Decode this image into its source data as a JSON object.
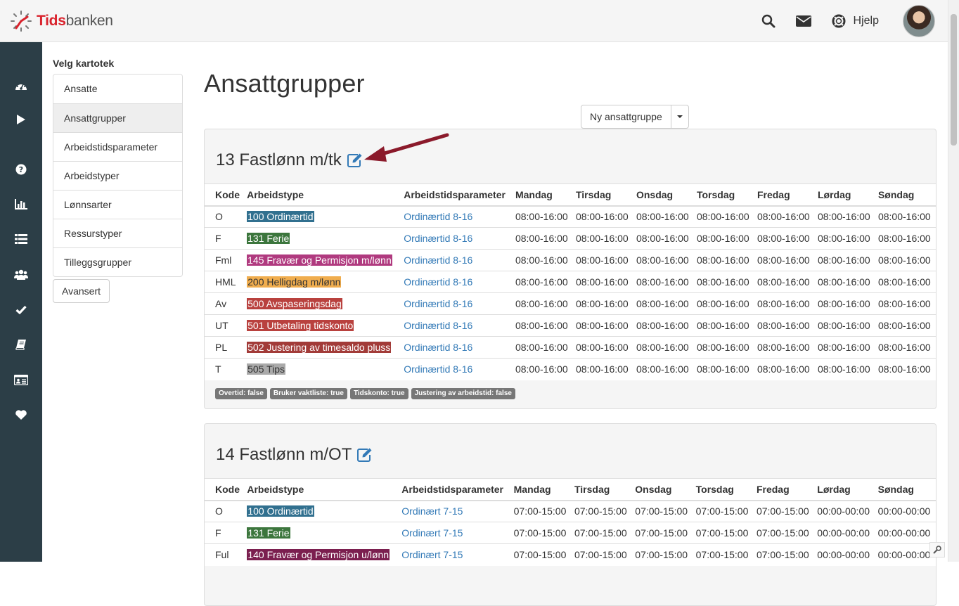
{
  "header": {
    "logo_part1": "Tids",
    "logo_part2": "banken",
    "help_label": "Hjelp",
    "icons": [
      "search-icon",
      "envelope-icon",
      "lifebuoy-icon"
    ]
  },
  "sidebar_icons": [
    "dashboard-icon",
    "play-icon",
    "question-icon",
    "bar-chart-icon",
    "list-icon",
    "users-icon",
    "check-icon",
    "book-icon",
    "id-card-icon",
    "heart-icon"
  ],
  "leftnav": {
    "title": "Velg kartotek",
    "items": [
      "Ansatte",
      "Ansattgrupper",
      "Arbeidstidsparameter",
      "Arbeidstyper",
      "Lønnsarter",
      "Ressurstyper",
      "Tilleggsgrupper"
    ],
    "active": "Ansattgrupper",
    "advanced_button": "Avansert"
  },
  "main": {
    "title": "Ansattgrupper",
    "new_button": "Ny ansattgruppe"
  },
  "table_headers": [
    "Kode",
    "Arbeidstype",
    "Arbeidstidsparameter",
    "Mandag",
    "Tirsdag",
    "Onsdag",
    "Torsdag",
    "Fredag",
    "Lørdag",
    "Søndag"
  ],
  "groups": [
    {
      "title": "13 Fastlønn m/tk",
      "rows": [
        {
          "kode": "O",
          "type": "100 Ordinærtid",
          "color": "#31708f",
          "param": "Ordinærtid 8-16",
          "days": [
            "08:00-16:00",
            "08:00-16:00",
            "08:00-16:00",
            "08:00-16:00",
            "08:00-16:00",
            "08:00-16:00",
            "08:00-16:00"
          ]
        },
        {
          "kode": "F",
          "type": "131 Ferie",
          "color": "#3c763d",
          "param": "Ordinærtid 8-16",
          "days": [
            "08:00-16:00",
            "08:00-16:00",
            "08:00-16:00",
            "08:00-16:00",
            "08:00-16:00",
            "08:00-16:00",
            "08:00-16:00"
          ]
        },
        {
          "kode": "Fml",
          "type": "145 Fravær og Permisjon m/lønn",
          "color": "#b03a7f",
          "param": "Ordinærtid 8-16",
          "days": [
            "08:00-16:00",
            "08:00-16:00",
            "08:00-16:00",
            "08:00-16:00",
            "08:00-16:00",
            "08:00-16:00",
            "08:00-16:00"
          ]
        },
        {
          "kode": "HML",
          "type": "200 Helligdag m/lønn",
          "color": "#f0ad4e",
          "textColor": "#333333",
          "param": "Ordinærtid 8-16",
          "days": [
            "08:00-16:00",
            "08:00-16:00",
            "08:00-16:00",
            "08:00-16:00",
            "08:00-16:00",
            "08:00-16:00",
            "08:00-16:00"
          ]
        },
        {
          "kode": "Av",
          "type": "500 Avspaseringsdag",
          "color": "#b9413e",
          "param": "Ordinærtid 8-16",
          "days": [
            "08:00-16:00",
            "08:00-16:00",
            "08:00-16:00",
            "08:00-16:00",
            "08:00-16:00",
            "08:00-16:00",
            "08:00-16:00"
          ]
        },
        {
          "kode": "UT",
          "type": "501 Utbetaling tidskonto",
          "color": "#b9413e",
          "param": "Ordinærtid 8-16",
          "days": [
            "08:00-16:00",
            "08:00-16:00",
            "08:00-16:00",
            "08:00-16:00",
            "08:00-16:00",
            "08:00-16:00",
            "08:00-16:00"
          ]
        },
        {
          "kode": "PL",
          "type": "502 Justering av timesaldo pluss",
          "color": "#a23b38",
          "param": "Ordinærtid 8-16",
          "days": [
            "08:00-16:00",
            "08:00-16:00",
            "08:00-16:00",
            "08:00-16:00",
            "08:00-16:00",
            "08:00-16:00",
            "08:00-16:00"
          ]
        },
        {
          "kode": "T",
          "type": "505 Tips",
          "color": "#aaaaaa",
          "textColor": "#333333",
          "param": "Ordinærtid 8-16",
          "days": [
            "08:00-16:00",
            "08:00-16:00",
            "08:00-16:00",
            "08:00-16:00",
            "08:00-16:00",
            "08:00-16:00",
            "08:00-16:00"
          ]
        }
      ],
      "tags": [
        "Overtid: false",
        "Bruker vaktliste: true",
        "Tidskonto: true",
        "Justering av arbeidstid: false"
      ]
    },
    {
      "title": "14 Fastlønn m/OT",
      "rows": [
        {
          "kode": "O",
          "type": "100 Ordinærtid",
          "color": "#31708f",
          "param": "Ordinært 7-15",
          "days": [
            "07:00-15:00",
            "07:00-15:00",
            "07:00-15:00",
            "07:00-15:00",
            "07:00-15:00",
            "00:00-00:00",
            "00:00-00:00"
          ]
        },
        {
          "kode": "F",
          "type": "131 Ferie",
          "color": "#3c763d",
          "param": "Ordinært 7-15",
          "days": [
            "07:00-15:00",
            "07:00-15:00",
            "07:00-15:00",
            "07:00-15:00",
            "07:00-15:00",
            "00:00-00:00",
            "00:00-00:00"
          ]
        },
        {
          "kode": "Ful",
          "type": "140 Fravær og Permisjon u/lønn",
          "color": "#7b1f4f",
          "param": "Ordinært 7-15",
          "days": [
            "07:00-15:00",
            "07:00-15:00",
            "07:00-15:00",
            "07:00-15:00",
            "07:00-15:00",
            "00:00-00:00",
            "00:00-00:00"
          ]
        }
      ],
      "tags": []
    }
  ]
}
